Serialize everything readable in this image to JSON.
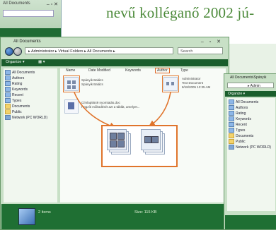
{
  "magazine": {
    "text": "nevű kolléganő 2002 jú-"
  },
  "back_window": {
    "title": "All Documents",
    "controls": "– ▫ ✕"
  },
  "main_window": {
    "title": "All Documents",
    "controls": "– ▫ ✕",
    "address": "▸ Administrator ▸ Virtual Folders ▸ All Documents ▸",
    "search_placeholder": "Search",
    "toolbar": {
      "organize": "Organize ▾",
      "views": "▦ ▾"
    },
    "sidebar": [
      {
        "label": "All Documents",
        "icon": "doc-icon"
      },
      {
        "label": "Authors",
        "icon": "doc-icon"
      },
      {
        "label": "Rating",
        "icon": "doc-icon"
      },
      {
        "label": "Keywords",
        "icon": "doc-icon"
      },
      {
        "label": "Recent",
        "icon": "doc-icon"
      },
      {
        "label": "Types",
        "icon": "doc-icon"
      },
      {
        "label": "Documents",
        "icon": "folder-icon"
      },
      {
        "label": "Public",
        "icon": "folder-icon"
      },
      {
        "label": "Network (PC WORLD)",
        "icon": "network-icon"
      }
    ],
    "columns": [
      "Name",
      "Date Modified",
      "Keywords",
      "Author",
      "Type"
    ],
    "files": [
      {
        "line1": "Spányik Balázs",
        "line2": "Spányik Balázs"
      },
      {
        "line1": "Administrator",
        "line2": "Text Document",
        "line3": "8/18/2005 12:35 AM"
      },
      {
        "line1": "Címlap5549 nyomtatás.doc",
        "line2": "Rögzíti működését azt a táblát, amelyet..."
      }
    ],
    "status": {
      "items": "2 items",
      "size": "Size: 115 KB"
    }
  },
  "right_window": {
    "title": "All Documents\\Spányik",
    "address": "▸ Admin",
    "toolbar": "Organize ▾",
    "sidebar": [
      "All Documents",
      "Authors",
      "Rating",
      "Keywords",
      "Recent",
      "Types",
      "Documents",
      "Public",
      "Network (PC WORLD)"
    ]
  },
  "colors": {
    "accent_orange": "#e0742c",
    "brand_green": "#1f6f33",
    "text_green": "#4c8a3a"
  }
}
